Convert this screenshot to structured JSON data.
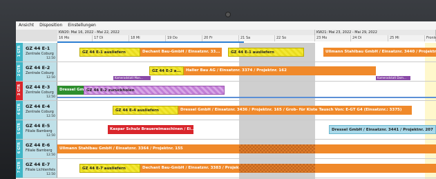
{
  "menu": [
    "Ansicht",
    "Disposition",
    "Einstellungen"
  ],
  "weeks": [
    {
      "label": "KW20: Mai 16, 2022 - Mai 22, 2022"
    },
    {
      "label": "KW21: Mai 23, 2022 - Mai 29, 2022"
    }
  ],
  "days": [
    "16 Mo",
    "17 Di",
    "18 Mi",
    "19 Do",
    "20 Fr",
    "21 Sa",
    "22 So",
    "23 Mo",
    "24 Di",
    "25 Mi",
    "Fronle"
  ],
  "rows": [
    {
      "stripe": "1 GTR",
      "name": "GZ 44 E-1",
      "sub": "Zentrale Coburg",
      "num": "12.50"
    },
    {
      "stripe": "2 GTR",
      "name": "GZ 44 E-2",
      "sub": "Zentrale Coburg",
      "num": "12.50"
    },
    {
      "stripe": "3 GTR",
      "name": "GZ 44 E-3",
      "sub": "Zentrale Coburg",
      "num": "12.50"
    },
    {
      "stripe": "4 GTR",
      "name": "GZ 44 E-4",
      "sub": "Zentrale Coburg",
      "num": "12.50"
    },
    {
      "stripe": "5 GTR",
      "name": "GZ 44 E-5",
      "sub": "Filiale Bamberg",
      "num": "12.50"
    },
    {
      "stripe": "6 GTR",
      "name": "GZ 44 E-6",
      "sub": "Filiale Bamberg",
      "num": "12.50"
    },
    {
      "stripe": "7 GTR",
      "name": "GZ 44 E-7",
      "sub": "Filiale Lichtenfels",
      "num": "12.50"
    }
  ],
  "bars": [
    "GZ 44 E-1 ausliefern",
    "Dechant Bau-GmbH / Einsatznr. 33...",
    "GZ 44 E-1 ausliefern",
    "Ullmann Stahlbau GmbH / Einsatznr. 3440 / Projektnr.",
    "GZ 44 E-2 a...",
    "Haller Bau AG / Einsatznr. 3374 / Projektnr. 162",
    "Kameradstatt Mon...",
    "Kameradstatt Dom...",
    "Dressel GmbH",
    "GZ 44 E-2 zurückholen",
    "GZ 44 E-4 ausliefern",
    "Dressel GmbH / Einsatznr. 3436 / Projektnr. 165 / Grob- für Kiste Tausch Von: E-GT G4 (Einsatznr.: 3375)",
    "Kaspar  Schulz Brauereimaschinen / Ei...",
    "Dressel GmbH / Einsatznr. 3441 / Projektnr. 207",
    "Ullmann Stahlbau GmbH / Einsatznr. 3364 / Projektnr. 155",
    "GZ 44 E-7 ausliefern",
    "Dechant Bau-GmbH / Einsatznr. 3383 / Projektnr. 167"
  ]
}
